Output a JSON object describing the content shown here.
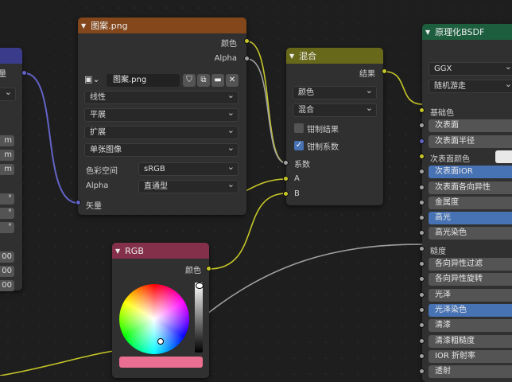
{
  "colors": {
    "image_header": "#83471b",
    "mix_header": "#68681a",
    "rgb_header": "#84304b",
    "bsdf_header": "#1d5e3e",
    "vector_header": "#3b3b8c",
    "socket_yellow": "#c7c729",
    "socket_grey": "#a1a1a1",
    "socket_purple": "#6363c7",
    "active_blue": "#4772b3"
  },
  "left_node": {
    "output_label": "矢量",
    "values": [
      "m",
      "m",
      "m",
      "°",
      "°",
      "°",
      "00",
      "00",
      "00"
    ]
  },
  "image_node": {
    "title": "图案.png",
    "outputs": [
      "颜色",
      "Alpha"
    ],
    "image_name": "图案.png",
    "icons": [
      "image-icon",
      "shield-icon",
      "copy-icon",
      "folder-icon",
      "close-icon"
    ],
    "interpolation": "线性",
    "projection": "平展",
    "extension": "扩展",
    "source": "单张图像",
    "colorspace_label": "色彩空间",
    "colorspace_value": "sRGB",
    "alpha_label": "Alpha",
    "alpha_value": "直通型",
    "input_label": "矢量"
  },
  "mix_node": {
    "title": "混合",
    "output": "结果",
    "data_type": "颜色",
    "blend_mode": "混合",
    "clamp_result": {
      "label": "钳制结果",
      "checked": false
    },
    "clamp_factor": {
      "label": "钳制系数",
      "checked": true
    },
    "inputs": [
      "系数",
      "A",
      "B"
    ]
  },
  "rgb_node": {
    "title": "RGB",
    "output": "颜色",
    "swatch_color": "#eb6f91"
  },
  "bsdf_node": {
    "title": "原理化BSDF",
    "distribution": "GGX",
    "subsurface_method": "随机游走",
    "rows": [
      {
        "label": "基础色",
        "kind": "label"
      },
      {
        "label": "次表面",
        "kind": "field"
      },
      {
        "label": "次表面半径",
        "kind": "field"
      },
      {
        "label": "次表面颜色",
        "kind": "color"
      },
      {
        "label": "次表面IOR",
        "kind": "blue"
      },
      {
        "label": "次表面各向异性",
        "kind": "field"
      },
      {
        "label": "金属度",
        "kind": "field"
      },
      {
        "label": "高光",
        "kind": "blue"
      },
      {
        "label": "高光染色",
        "kind": "field"
      },
      {
        "label": "糙度",
        "kind": "label"
      },
      {
        "label": "各向异性过滤",
        "kind": "field"
      },
      {
        "label": "各向异性旋转",
        "kind": "field"
      },
      {
        "label": "光泽",
        "kind": "field"
      },
      {
        "label": "光泽染色",
        "kind": "blue"
      },
      {
        "label": "清漆",
        "kind": "field"
      },
      {
        "label": "清漆粗糙度",
        "kind": "field"
      },
      {
        "label": "IOR 折射率",
        "kind": "field"
      },
      {
        "label": "透射",
        "kind": "field"
      }
    ]
  }
}
